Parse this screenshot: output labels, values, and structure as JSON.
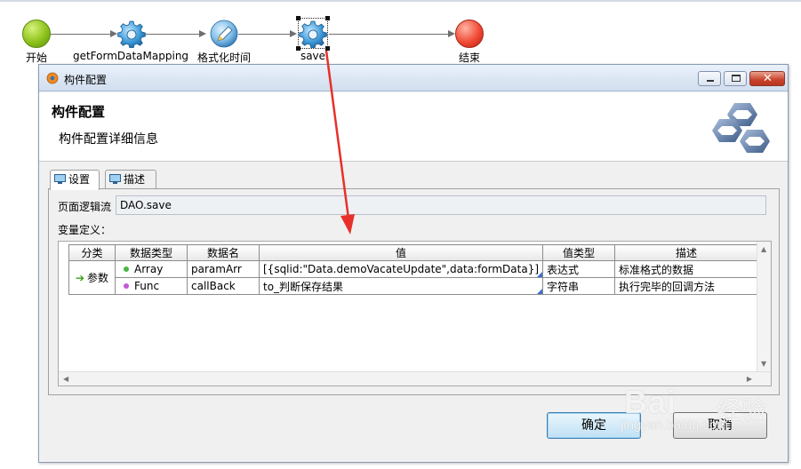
{
  "flow": {
    "nodes": [
      {
        "label": "开始",
        "type": "start"
      },
      {
        "label": "getFormDataMapping",
        "type": "gear"
      },
      {
        "label": "格式化时间",
        "type": "pen"
      },
      {
        "label": "save",
        "type": "gear",
        "selected": true
      },
      {
        "label": "结束",
        "type": "end"
      }
    ],
    "icons": {
      "start": "green-circle-icon",
      "end": "red-circle-icon",
      "gear": "gear-icon",
      "pen": "pen-icon"
    }
  },
  "dialog": {
    "title": "构件配置",
    "header_title": "构件配置",
    "header_subtitle": "构件配置详细信息",
    "tabs": [
      {
        "label": "设置",
        "active": true
      },
      {
        "label": "描述",
        "active": false
      }
    ],
    "page_flow_label": "页面逻辑流",
    "page_flow_value": "DAO.save",
    "variables_label": "变量定义：",
    "table": {
      "headers": [
        "分类",
        "数据类型",
        "数据名",
        "值",
        "值类型",
        "描述"
      ],
      "category": "参数",
      "rows": [
        {
          "type": "Array",
          "name": "paramArr",
          "value": "[{sqlid:\"Data.demoVacateUpdate\",data:formData}]",
          "value_type": "表达式",
          "desc": "标准格式的数据",
          "dot_color": "#4bb543"
        },
        {
          "type": "Func",
          "name": "callBack",
          "value": "to_判断保存结果",
          "value_type": "字符串",
          "desc": "执行完毕的回调方法",
          "dot_color": "#c05bd1"
        }
      ]
    },
    "ok_label": "确定",
    "cancel_label": "取消"
  },
  "watermark": {
    "brand": "Bai",
    "cn": "经验",
    "url": "jingyan.baidu.com"
  },
  "colors": {
    "annotation_arrow": "#e8302a",
    "accent": "#3c7fb1"
  }
}
